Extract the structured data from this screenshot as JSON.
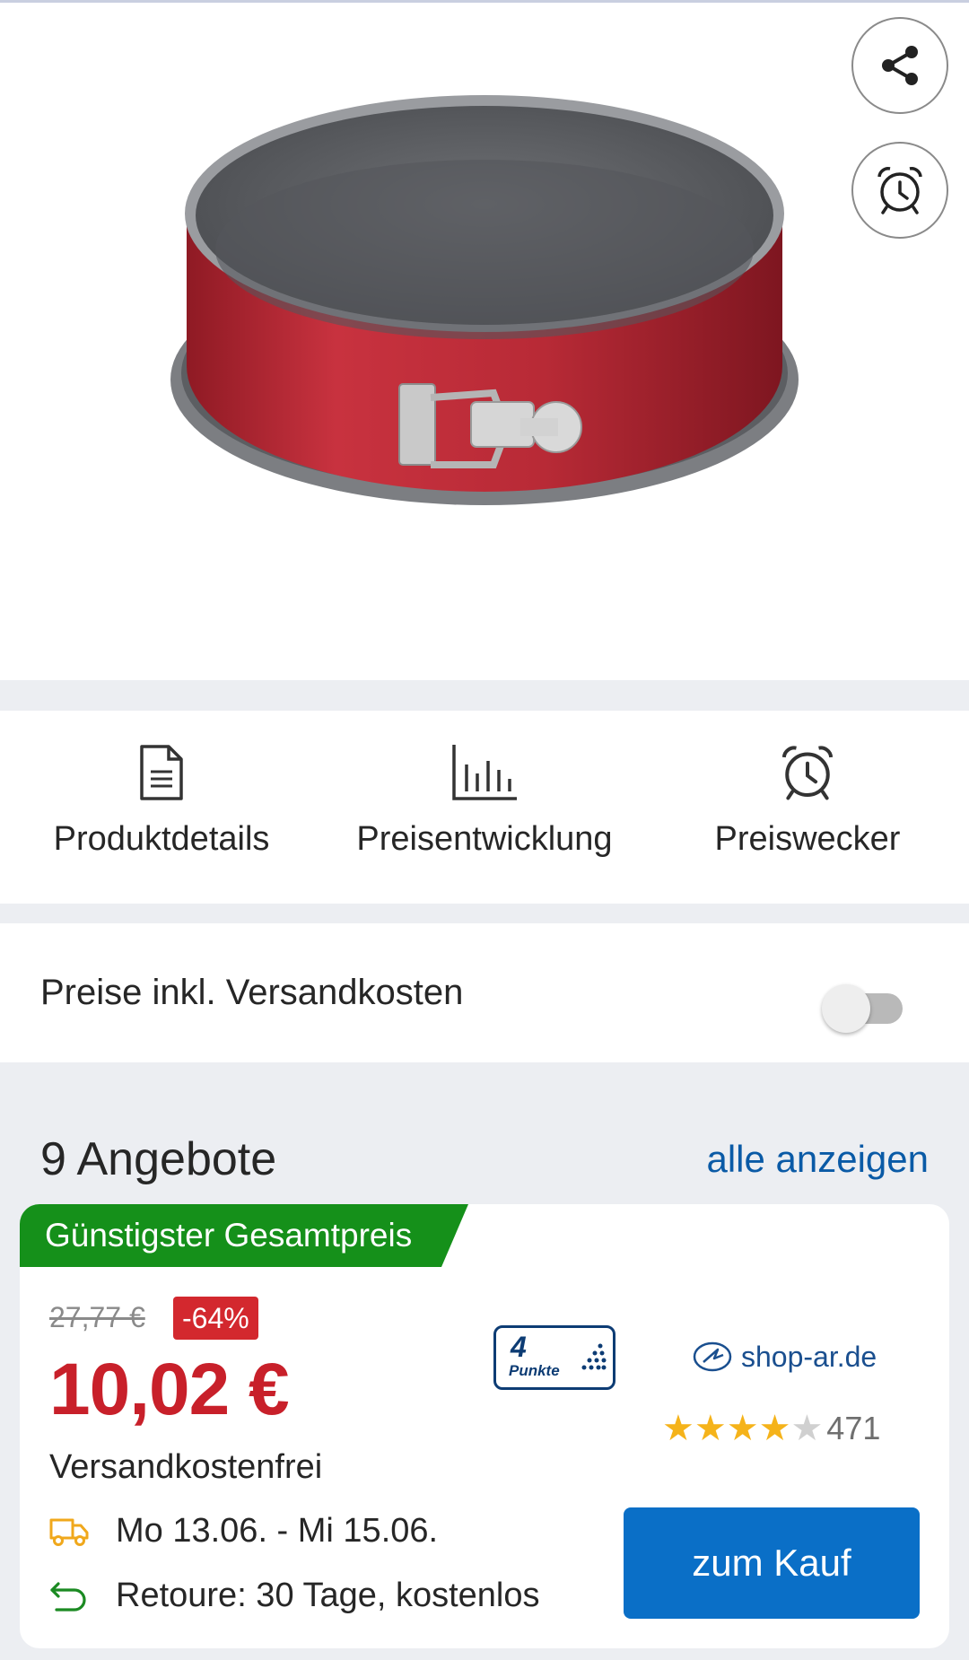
{
  "product": {
    "image_alt": "Springform"
  },
  "actions": [
    {
      "label": "Produktdetails",
      "icon": "document-icon"
    },
    {
      "label": "Preisentwicklung",
      "icon": "bar-chart-icon"
    },
    {
      "label": "Preiswecker",
      "icon": "alarm-clock-icon"
    }
  ],
  "shipping_toggle": {
    "label": "Preise inkl. Versandkosten",
    "enabled": false
  },
  "offers": {
    "title": "9 Angebote",
    "show_all": "alle anzeigen",
    "top_offer": {
      "badge": "Günstigster Gesamtpreis",
      "old_price": "27,77 €",
      "discount": "-64%",
      "price": "10,02 €",
      "shipping": "Versandkostenfrei",
      "delivery": "Mo 13.06. - Mi 15.06.",
      "returns": "Retoure: 30 Tage, kostenlos",
      "points_number": "4",
      "points_label": "Punkte",
      "shop_name": "shop-ar.de",
      "rating_stars": 4,
      "rating_max": 5,
      "rating_count": "471",
      "buy_label": "zum Kauf"
    }
  },
  "colors": {
    "accent_blue": "#0a6fc7",
    "link_blue": "#0a5aa6",
    "price_red": "#c8202a",
    "badge_green": "#15901a",
    "star_yellow": "#f5b31a"
  }
}
